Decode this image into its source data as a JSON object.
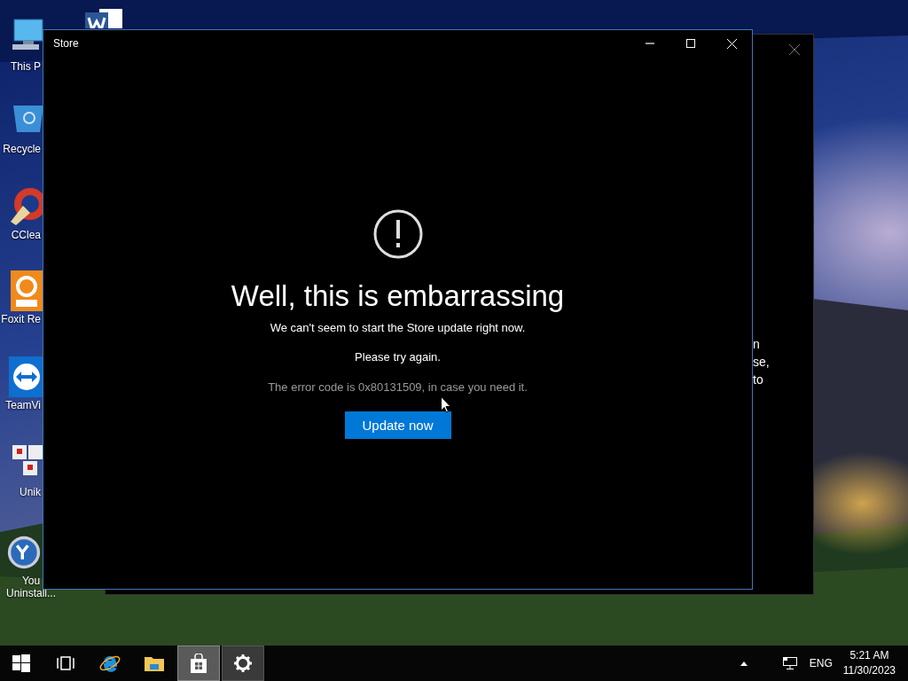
{
  "desktop_icons": [
    {
      "kind": "computer",
      "label": "This P"
    },
    {
      "kind": "word"
    },
    {
      "kind": "recycle",
      "label": "Recycle"
    },
    {
      "kind": "broom",
      "label": "CClea"
    },
    {
      "kind": "pdf",
      "label": "Foxit Re"
    },
    {
      "kind": "remote",
      "label": "TeamVi"
    },
    {
      "kind": "keys",
      "label": "Unik"
    },
    {
      "kind": "uninstaller",
      "label": "You Uninstall..."
    }
  ],
  "back_window": {
    "text_lines": [
      "n",
      "se,",
      "to"
    ]
  },
  "window": {
    "title": "Store",
    "heading": "Well, this is embarrassing",
    "messages": [
      "We can't seem to start the Store update right now.",
      "Please try again."
    ],
    "error_note": "The error code is 0x80131509, in case you need it.",
    "button": "Update now"
  },
  "taskbar": {
    "apps": [
      {
        "kind": "task-view",
        "running": false,
        "selected": false
      },
      {
        "kind": "browser",
        "running": false,
        "selected": false
      },
      {
        "kind": "folder",
        "running": false,
        "selected": false
      },
      {
        "kind": "store",
        "running": true,
        "selected": true
      },
      {
        "kind": "settings",
        "running": true,
        "selected": false
      }
    ],
    "language": "ENG",
    "time": "5:21 AM",
    "date": "11/30/2023"
  }
}
